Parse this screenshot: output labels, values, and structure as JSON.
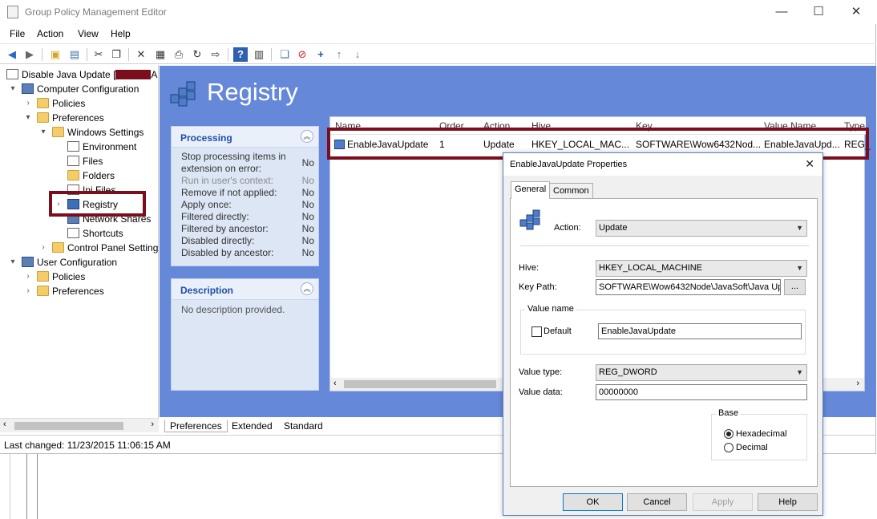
{
  "window": {
    "title": "Group Policy Management Editor",
    "controls": {
      "minimize": "—",
      "maximize": "☐",
      "close": "✕"
    }
  },
  "menu": [
    "File",
    "Action",
    "View",
    "Help"
  ],
  "tree": {
    "root": "Disable Java Update [",
    "root_suffix": "AI",
    "computer_config": "Computer Configuration",
    "policies": "Policies",
    "preferences": "Preferences",
    "windows_settings": "Windows Settings",
    "environment": "Environment",
    "files": "Files",
    "folders": "Folders",
    "ini_files": "Ini Files",
    "registry": "Registry",
    "network_shares": "Network Shares",
    "shortcuts": "Shortcuts",
    "control_panel": "Control Panel Settings",
    "user_config": "User Configuration",
    "user_policies": "Policies",
    "user_preferences": "Preferences"
  },
  "status": {
    "text": "Last changed: 11/23/2015 11:06:15 AM"
  },
  "registry_title": "Registry",
  "processing": {
    "title": "Processing",
    "rows": [
      {
        "label": "Stop processing items in extension on error:",
        "value": "No"
      },
      {
        "label": "Run in user's context:",
        "value": "No"
      },
      {
        "label": "Remove if not applied:",
        "value": "No"
      },
      {
        "label": "Apply once:",
        "value": "No"
      },
      {
        "label": "Filtered directly:",
        "value": "No"
      },
      {
        "label": "Filtered by ancestor:",
        "value": "No"
      },
      {
        "label": "Disabled directly:",
        "value": "No"
      },
      {
        "label": "Disabled by ancestor:",
        "value": "No"
      }
    ]
  },
  "description": {
    "title": "Description",
    "text": "No description provided."
  },
  "grid": {
    "columns": [
      "Name",
      "Order",
      "Action",
      "Hive",
      "Key",
      "Value Name",
      "Type"
    ],
    "row": {
      "name": "EnableJavaUpdate",
      "order": "1",
      "action": "Update",
      "hive": "HKEY_LOCAL_MAC...",
      "key": "SOFTWARE\\Wow6432Nod...",
      "value_name": "EnableJavaUpd...",
      "type": "REG_"
    }
  },
  "bottom_tabs": [
    "Preferences",
    "Extended",
    "Standard"
  ],
  "dialog": {
    "title": "EnableJavaUpdate Properties",
    "tabs": [
      "General",
      "Common"
    ],
    "action_label": "Action:",
    "action_value": "Update",
    "hive_label": "Hive:",
    "hive_value": "HKEY_LOCAL_MACHINE",
    "keypath_label": "Key Path:",
    "keypath_value": "SOFTWARE\\Wow6432Node\\JavaSoft\\Java Up",
    "browse": "...",
    "value_name_group": "Value name",
    "default_label": "Default",
    "value_name": "EnableJavaUpdate",
    "value_type_label": "Value type:",
    "value_type": "REG_DWORD",
    "value_data_label": "Value data:",
    "value_data": "00000000",
    "base_group": "Base",
    "hex_label": "Hexadecimal",
    "dec_label": "Decimal",
    "buttons": {
      "ok": "OK",
      "cancel": "Cancel",
      "apply": "Apply",
      "help": "Help"
    }
  },
  "colors": {
    "content_bg": "#6588d8",
    "highlight": "#7b0e1c",
    "panel_title": "#1b4ea7"
  }
}
